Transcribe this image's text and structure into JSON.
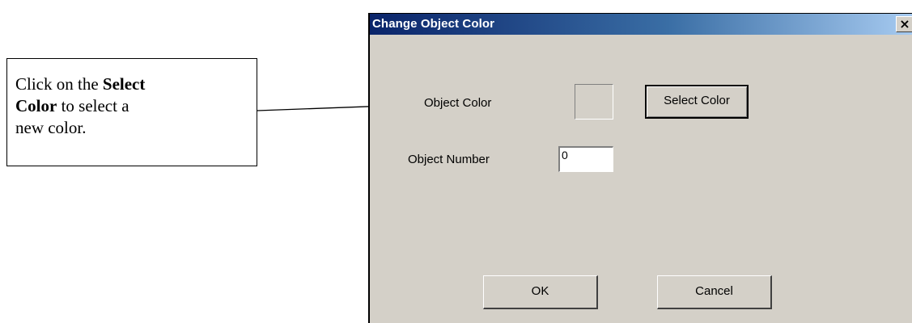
{
  "callout": {
    "line1_pre": "Click on the ",
    "line1_bold": "Select",
    "line2_bold": "Color",
    "line2_post": " to select a",
    "line3": "new color."
  },
  "dialog": {
    "title": "Change Object Color",
    "close_label": "×",
    "object_color_label": "Object Color",
    "select_color_button": "Select Color",
    "object_number_label": "Object Number",
    "object_number_value": "0",
    "ok_button": "OK",
    "cancel_button": "Cancel"
  },
  "colors": {
    "dialog_face": "#d4d0c8",
    "titlebar_start": "#0a246a",
    "titlebar_end": "#a6caf0",
    "swatch_color": "#d4d0c8"
  }
}
